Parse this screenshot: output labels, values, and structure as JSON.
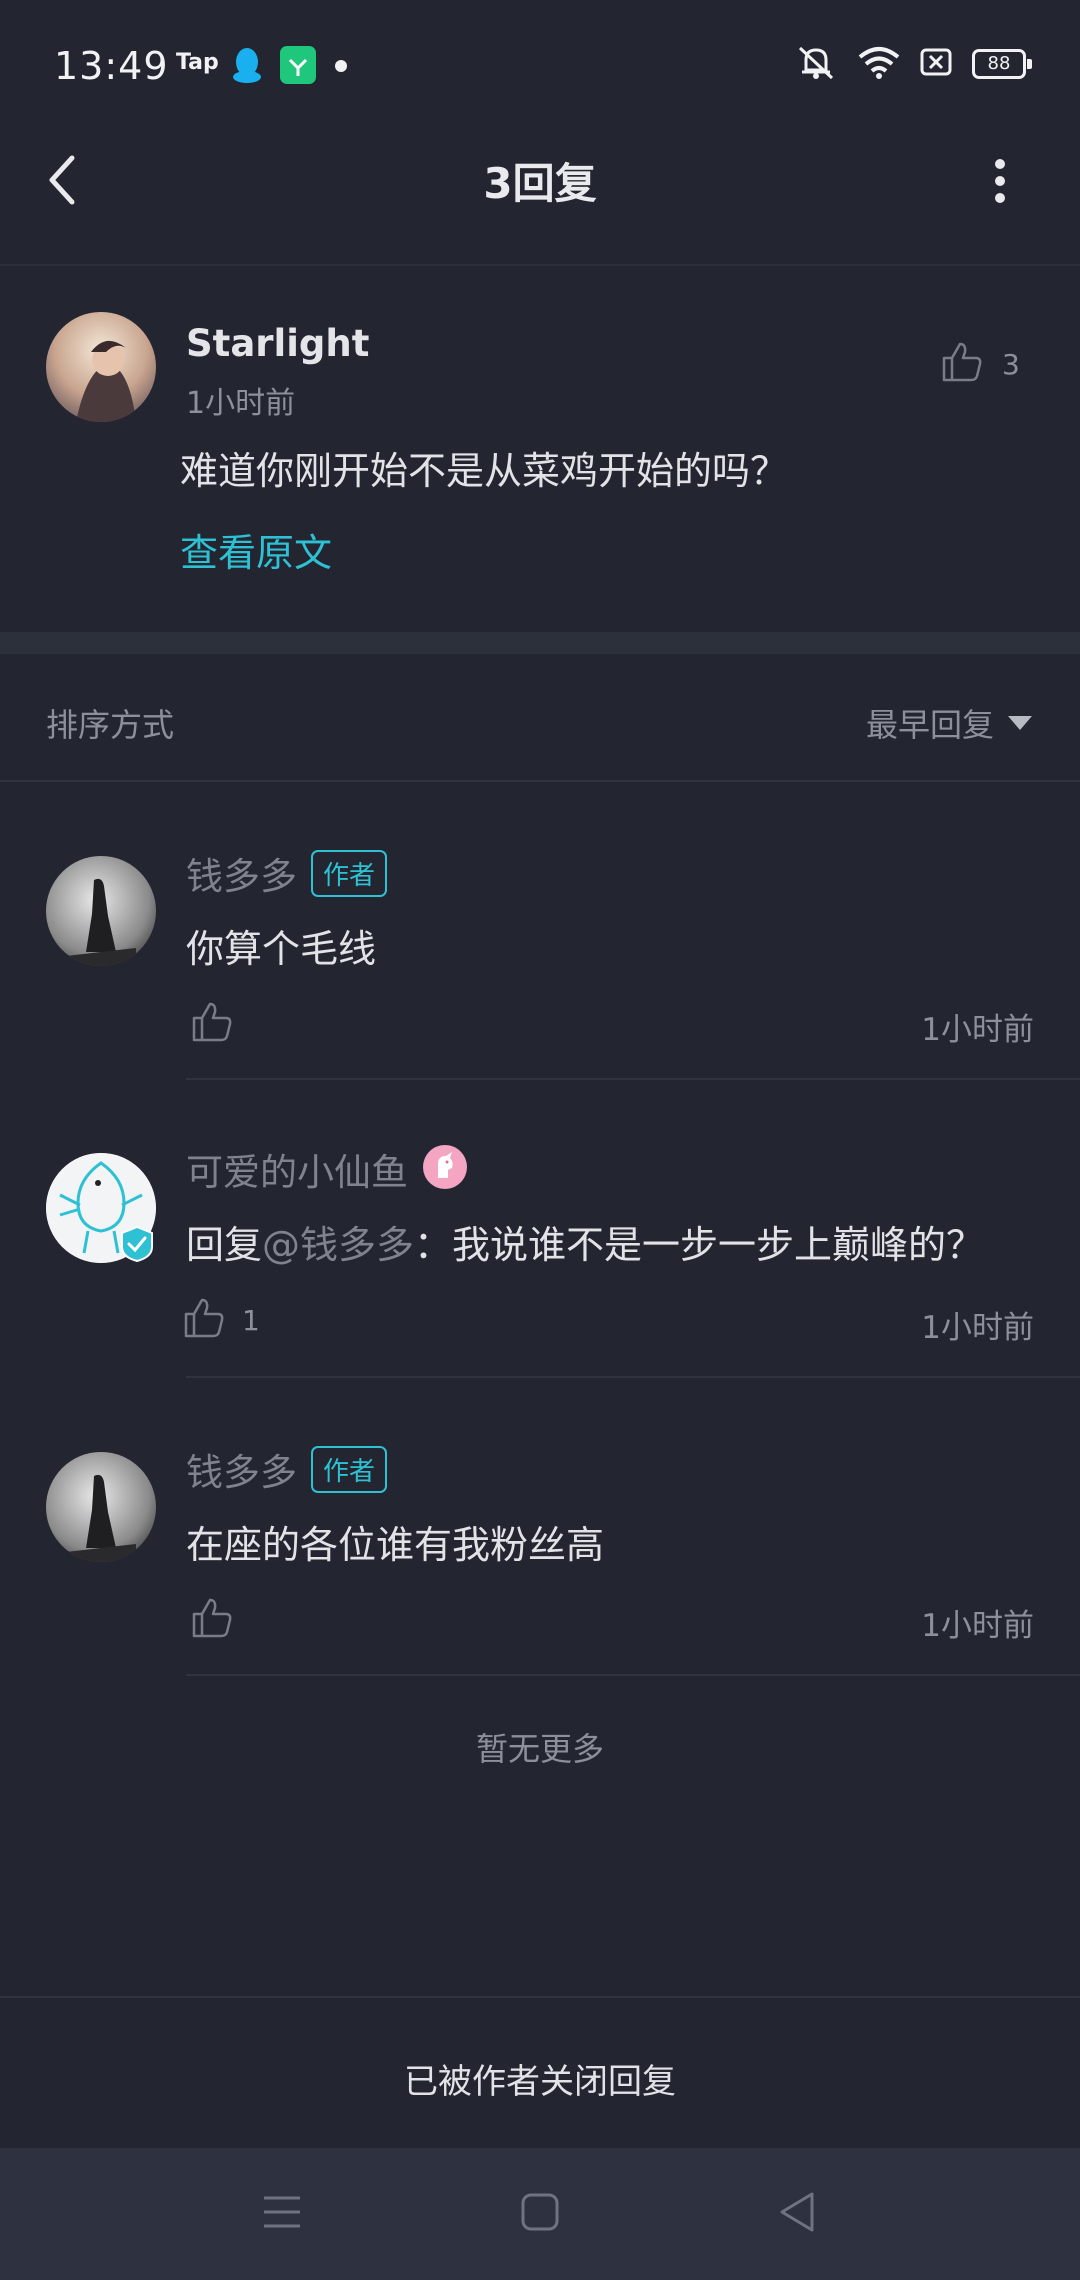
{
  "status_bar": {
    "time": "13:49",
    "tap_label": "Tap",
    "battery": "88",
    "icons": [
      "qq-icon",
      "wechat-icon",
      "notification-dot-icon",
      "mute-icon",
      "wifi-icon",
      "no-sim-icon",
      "battery-icon"
    ]
  },
  "nav": {
    "title": "3回复",
    "icons": [
      "back-icon",
      "more-icon"
    ]
  },
  "original_post": {
    "author": "Starlight",
    "time": "1小时前",
    "likes": "3",
    "content": "难道你刚开始不是从菜鸡开始的吗？",
    "view_original": "查看原文"
  },
  "sort": {
    "label": "排序方式",
    "selected": "最早回复"
  },
  "replies": [
    {
      "author": "钱多多",
      "badge": "作者",
      "content": "你算个毛线",
      "likes": "",
      "time": "1小时前"
    },
    {
      "author": "可爱的小仙鱼",
      "reply_prefix": "回复",
      "mention": "@钱多多",
      "content": "：我说谁不是一步一步上巅峰的？",
      "likes": "1",
      "time": "1小时前"
    },
    {
      "author": "钱多多",
      "badge": "作者",
      "content": "在座的各位谁有我粉丝高",
      "likes": "",
      "time": "1小时前"
    }
  ],
  "no_more": "暂无更多",
  "closed_notice": "已被作者关闭回复",
  "system_nav": [
    "menu-icon",
    "home-icon",
    "back-triangle-icon"
  ],
  "colors": {
    "background": "#232631",
    "accent": "#2ec0d3",
    "muted_text": "#8d909a",
    "system_nav_bg": "#2e3240"
  }
}
